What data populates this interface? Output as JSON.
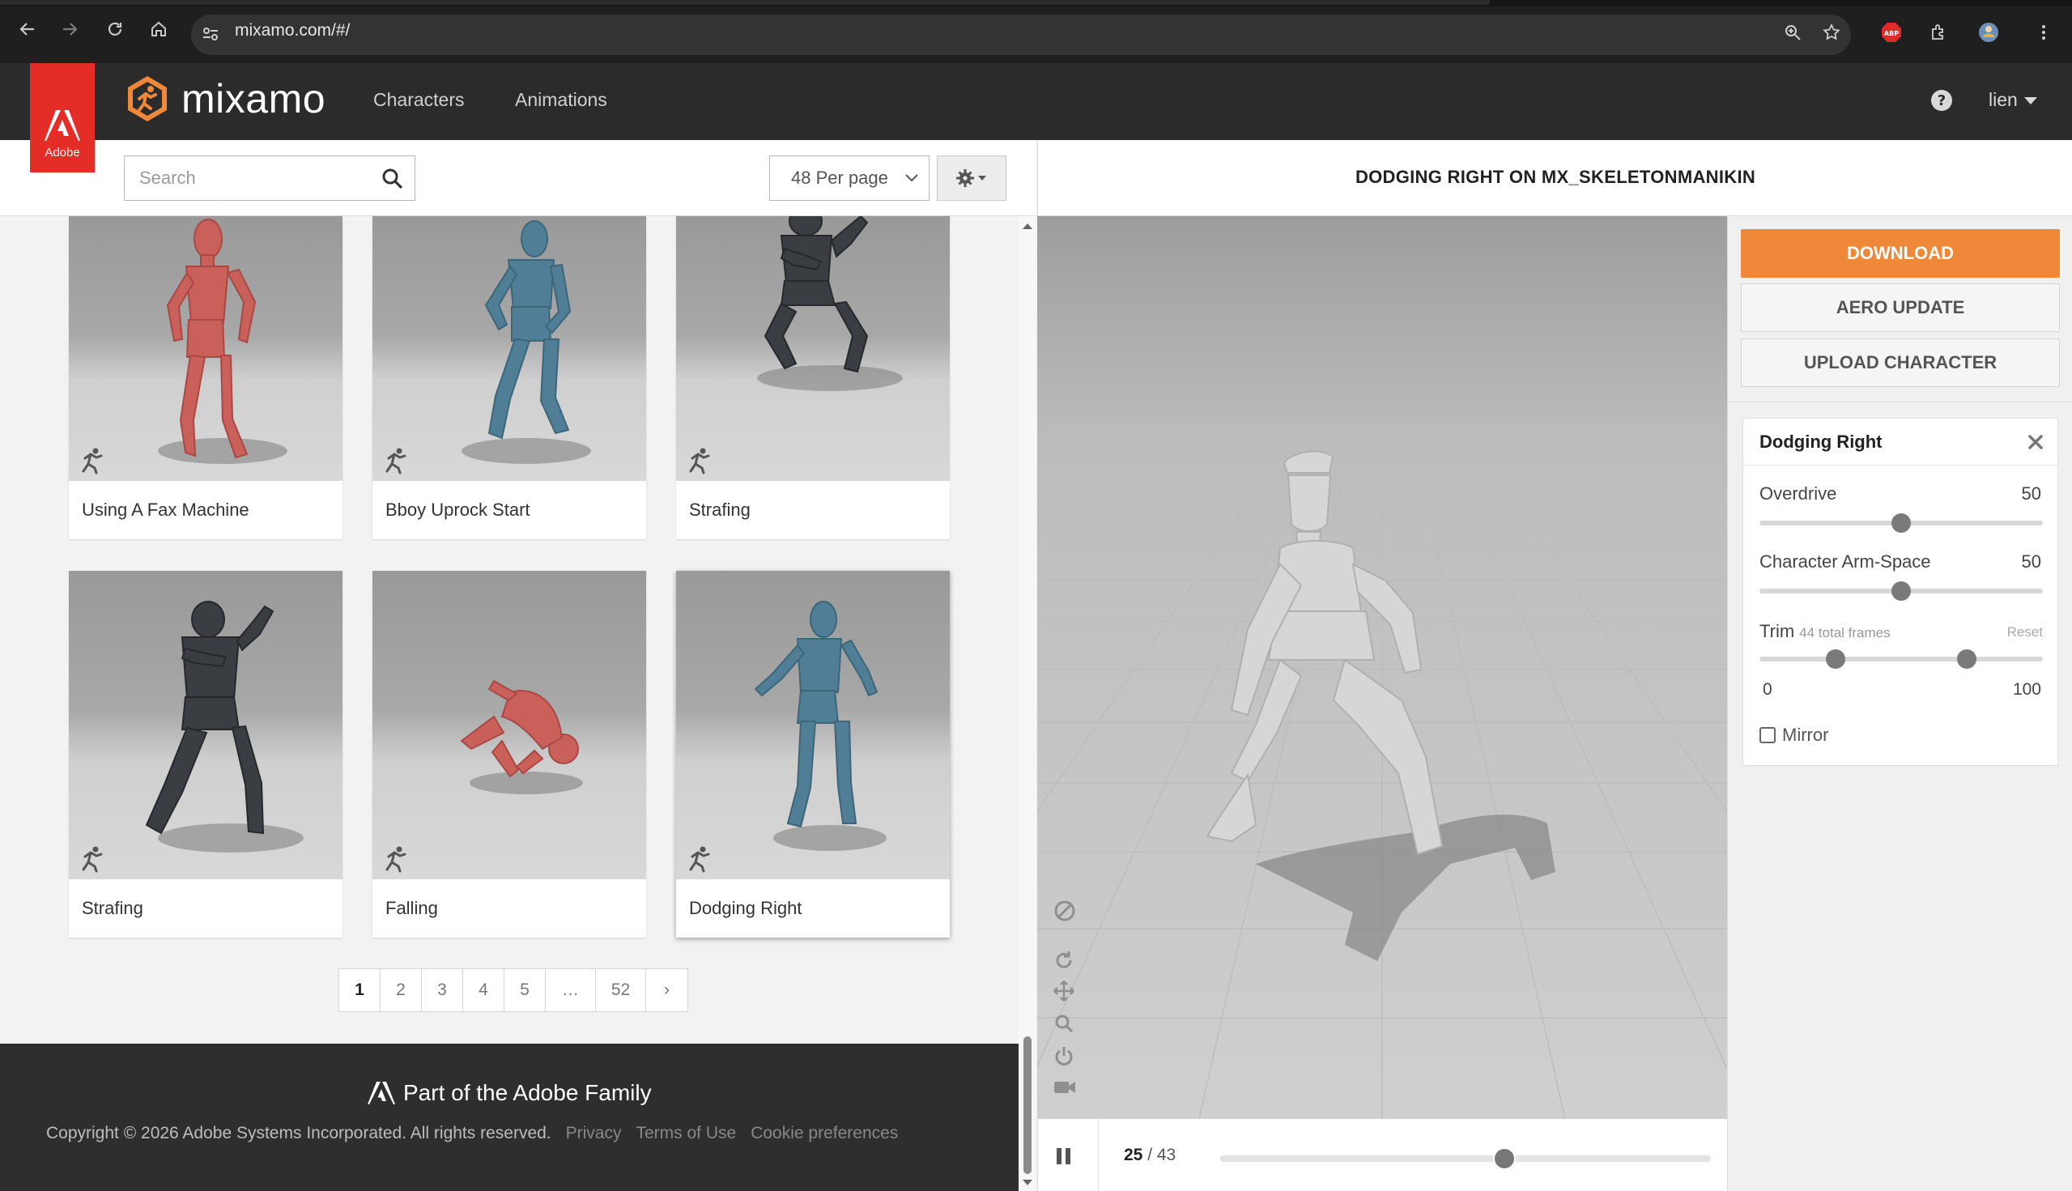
{
  "browser": {
    "url": "mixamo.com/#/"
  },
  "header": {
    "adobe_label": "Adobe",
    "brand": "mixamo",
    "nav": [
      "Characters",
      "Animations"
    ],
    "user": "lien"
  },
  "toolbar": {
    "search_placeholder": "Search",
    "per_page": "48 Per page"
  },
  "cards": [
    {
      "title": "Using A Fax Machine",
      "color": "#c9605a"
    },
    {
      "title": "Bboy Uprock Start",
      "color": "#4f7e96"
    },
    {
      "title": "Strafing",
      "color": "#3a3d42"
    },
    {
      "title": "Strafing",
      "color": "#3a3d42"
    },
    {
      "title": "Falling",
      "color": "#c9605a"
    },
    {
      "title": "Dodging Right",
      "color": "#4f7e96"
    }
  ],
  "pagination": {
    "pages": [
      "1",
      "2",
      "3",
      "4",
      "5",
      "…",
      "52"
    ],
    "active": "1",
    "next": "›"
  },
  "footer": {
    "brand": "Part of the Adobe Family",
    "copyright": "Copyright © 2026 Adobe Systems Incorporated. All rights reserved.",
    "links": [
      "Privacy",
      "Terms of Use",
      "Cookie preferences"
    ]
  },
  "viewer": {
    "title": "DODGING RIGHT ON MX_SKELETONMANIKIN",
    "frame_current": "25",
    "frame_sep": " / ",
    "frame_total": "43",
    "progress": 0.58
  },
  "sidebar": {
    "download": "DOWNLOAD",
    "aero_update": "AERO UPDATE",
    "upload_character": "UPLOAD CHARACTER",
    "panel_title": "Dodging Right",
    "overdrive_label": "Overdrive",
    "overdrive_value": "50",
    "armspace_label": "Character Arm-Space",
    "armspace_value": "50",
    "trim_label": "Trim",
    "trim_sub": "44 total frames",
    "trim_reset": "Reset",
    "trim_min": "0",
    "trim_max": "100",
    "mirror_label": "Mirror"
  },
  "colors": {
    "download": "#f0883a",
    "adobe_red": "#e52d27",
    "header": "#2b2b2b"
  }
}
